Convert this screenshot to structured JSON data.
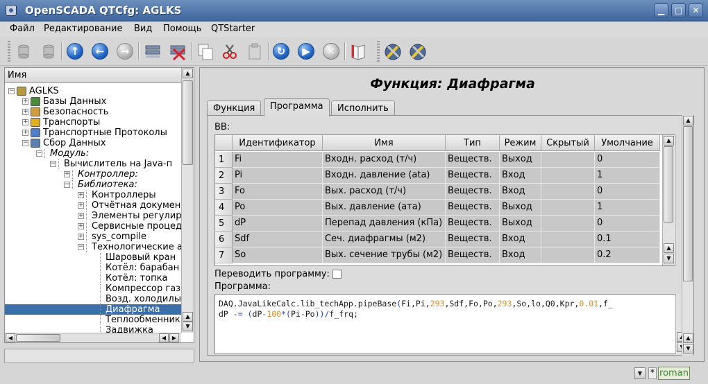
{
  "window": {
    "title": "OpenSCADA QTCfg: AGLKS"
  },
  "menu": [
    "Файл",
    "Редактирование",
    "Вид",
    "Помощь",
    "QTStarter"
  ],
  "tree": {
    "header": "Имя",
    "items": [
      {
        "label": "AGLKS",
        "depth": 0,
        "italic": false
      },
      {
        "label": "Базы Данных",
        "depth": 1,
        "italic": false
      },
      {
        "label": "Безопасность",
        "depth": 1,
        "italic": false
      },
      {
        "label": "Транспорты",
        "depth": 1,
        "italic": false
      },
      {
        "label": "Транспортные Протоколы",
        "depth": 1,
        "italic": false
      },
      {
        "label": "Сбор Данных",
        "depth": 1,
        "italic": false
      },
      {
        "label": "Модуль:",
        "depth": 2,
        "italic": true
      },
      {
        "label": "Вычислитель на Java-п",
        "depth": 3,
        "italic": false
      },
      {
        "label": "Контроллер:",
        "depth": 4,
        "italic": true
      },
      {
        "label": "Библиотека:",
        "depth": 4,
        "italic": true
      },
      {
        "label": "Контроллеры",
        "depth": 5,
        "italic": false
      },
      {
        "label": "Отчётная докумен",
        "depth": 5,
        "italic": false
      },
      {
        "label": "Элементы регулир",
        "depth": 5,
        "italic": false
      },
      {
        "label": "Сервисные процед",
        "depth": 5,
        "italic": false
      },
      {
        "label": "sys_compile",
        "depth": 5,
        "italic": false
      },
      {
        "label": "Технологические а",
        "depth": 5,
        "italic": false
      },
      {
        "label": "Шаровый кран",
        "depth": 6,
        "italic": false
      },
      {
        "label": "Котёл: барабан",
        "depth": 6,
        "italic": false
      },
      {
        "label": "Котёл: топка",
        "depth": 6,
        "italic": false
      },
      {
        "label": "Компрессор газо",
        "depth": 6,
        "italic": false
      },
      {
        "label": "Возд. холодилы",
        "depth": 6,
        "italic": false
      },
      {
        "label": "Диафрагма",
        "depth": 6,
        "italic": false
      },
      {
        "label": "Теплообменник",
        "depth": 6,
        "italic": false
      },
      {
        "label": "Задвижка",
        "depth": 6,
        "italic": false
      }
    ]
  },
  "panel": {
    "title": "Функция: Диафрагма",
    "tabs": [
      "Функция",
      "Программа",
      "Исполнить"
    ],
    "active_tab": "Программа",
    "vv_label": "ВВ:",
    "table": {
      "columns": [
        "Идентификатор",
        "Имя",
        "Тип",
        "Режим",
        "Скрытый",
        "Умолчание"
      ],
      "rows": [
        {
          "n": "1",
          "id": "Fi",
          "name": "Входн. расход (т/ч)",
          "type": "Веществ.",
          "mode": "Выход",
          "hidden": "",
          "default": "0"
        },
        {
          "n": "2",
          "id": "Pi",
          "name": "Входн. давление (ata)",
          "type": "Веществ.",
          "mode": "Вход",
          "hidden": "",
          "default": "1"
        },
        {
          "n": "3",
          "id": "Fo",
          "name": "Вых. расход (т/ч)",
          "type": "Веществ.",
          "mode": "Вход",
          "hidden": "",
          "default": "0"
        },
        {
          "n": "4",
          "id": "Po",
          "name": "Вых. давление (ата)",
          "type": "Веществ.",
          "mode": "Выход",
          "hidden": "",
          "default": "1"
        },
        {
          "n": "5",
          "id": "dP",
          "name": "Перепад давления (кПа)",
          "type": "Веществ.",
          "mode": "Выход",
          "hidden": "",
          "default": "0"
        },
        {
          "n": "6",
          "id": "Sdf",
          "name": "Сеч. диафрагмы (м2)",
          "type": "Веществ.",
          "mode": "Вход",
          "hidden": "",
          "default": "0.1"
        },
        {
          "n": "7",
          "id": "So",
          "name": "Вых. сечение трубы (м2)",
          "type": "Веществ.",
          "mode": "Вход",
          "hidden": "",
          "default": "0.2"
        }
      ]
    },
    "translate_label": "Переводить программу:",
    "program_label": "Программа:",
    "code_lines": [
      [
        {
          "t": "DAQ.JavaLikeCalc.lib_techApp.pipeBase",
          "c": "txt"
        },
        {
          "t": "(",
          "c": "op"
        },
        {
          "t": "Fi,Pi,",
          "c": "txt"
        },
        {
          "t": "293",
          "c": "num"
        },
        {
          "t": ",Sdf,Fo,Po,",
          "c": "txt"
        },
        {
          "t": "293",
          "c": "num"
        },
        {
          "t": ",So,lo,Q0,Kpr,",
          "c": "txt"
        },
        {
          "t": "0.01",
          "c": "num"
        },
        {
          "t": ",f_",
          "c": "txt"
        }
      ],
      [
        {
          "t": "dP ",
          "c": "txt"
        },
        {
          "t": "-=",
          "c": "op"
        },
        {
          "t": " ",
          "c": "txt"
        },
        {
          "t": "(",
          "c": "op"
        },
        {
          "t": "dP",
          "c": "txt"
        },
        {
          "t": "-",
          "c": "op"
        },
        {
          "t": "100",
          "c": "num"
        },
        {
          "t": "*(",
          "c": "op"
        },
        {
          "t": "Pi",
          "c": "txt"
        },
        {
          "t": "-",
          "c": "op"
        },
        {
          "t": "Po",
          "c": "txt"
        },
        {
          "t": "))/",
          "c": "op"
        },
        {
          "t": "f_frq;",
          "c": "txt"
        }
      ]
    ]
  },
  "status": {
    "user": "roman"
  }
}
